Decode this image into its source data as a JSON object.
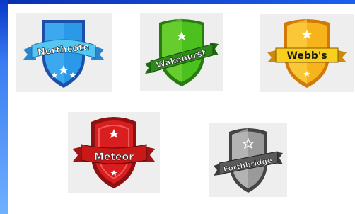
{
  "crests": [
    {
      "name": "Northcote",
      "colors": {
        "shield": "#2a9ae8",
        "rim": "#1b4fa8",
        "ribbon": "#55c6f2"
      }
    },
    {
      "name": "Wakehurst",
      "colors": {
        "shield": "#4cc01c",
        "rim": "#2a7a12",
        "ribbon": "#2e8a1a"
      }
    },
    {
      "name": "Webb's",
      "colors": {
        "shield": "#f6b31c",
        "rim": "#d27a08",
        "ribbon": "#f9cf1d"
      }
    },
    {
      "name": "Meteor",
      "colors": {
        "shield": "#d81e1e",
        "rim": "#8e1111",
        "ribbon": "#c81818"
      }
    },
    {
      "name": "Forthbridge",
      "colors": {
        "shield": "#9a9a9a",
        "rim": "#444444",
        "ribbon": "#5a5a5a"
      }
    }
  ]
}
